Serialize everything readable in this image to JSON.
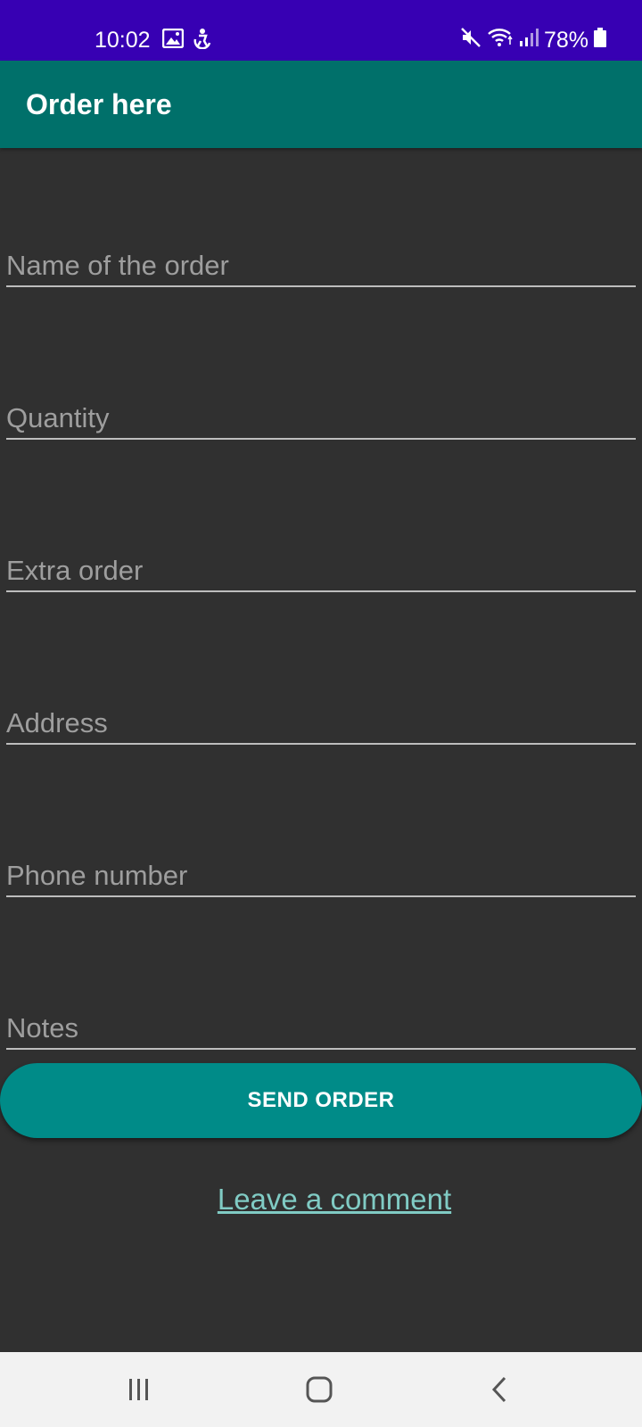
{
  "status_bar": {
    "time": "10:02",
    "battery": "78%",
    "icons": [
      "image-icon",
      "accessibility-icon",
      "mute-icon",
      "wifi-icon",
      "signal-icon",
      "battery-icon"
    ]
  },
  "app_bar": {
    "title": "Order here"
  },
  "form": {
    "fields": [
      {
        "placeholder": "Name of the order",
        "value": ""
      },
      {
        "placeholder": "Quantity",
        "value": ""
      },
      {
        "placeholder": "Extra order",
        "value": ""
      },
      {
        "placeholder": "Address",
        "value": ""
      },
      {
        "placeholder": "Phone number",
        "value": ""
      },
      {
        "placeholder": "Notes",
        "value": ""
      }
    ],
    "send_label": "SEND ORDER",
    "comment_link": "Leave a comment"
  },
  "nav_bar": {
    "icons": [
      "recents-icon",
      "home-icon",
      "back-icon"
    ]
  },
  "colors": {
    "status_bar": "#3700b3",
    "app_bar": "#00706a",
    "background": "#303030",
    "button": "#008b88",
    "link": "#80cbc4"
  }
}
